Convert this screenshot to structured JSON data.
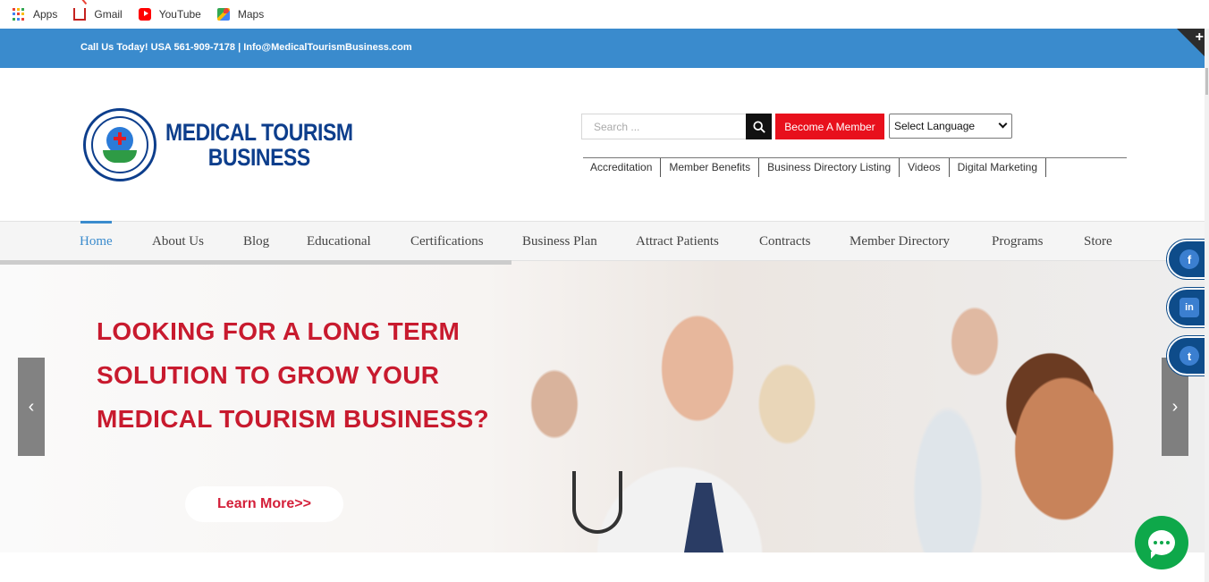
{
  "bookmarks": [
    {
      "label": "Apps",
      "icon": "apps-grid-icon"
    },
    {
      "label": "Gmail",
      "icon": "gmail-icon"
    },
    {
      "label": "YouTube",
      "icon": "youtube-icon"
    },
    {
      "label": "Maps",
      "icon": "maps-icon"
    }
  ],
  "topbar": {
    "contact": "Call Us Today! USA 561-909-7178  |  Info@MedicalTourismBusiness.com",
    "corner_symbol": "+",
    "color": "#3a8bcd"
  },
  "logo": {
    "line1": "MEDICAL TOURISM",
    "line2": "BUSINESS",
    "color": "#0d3e8c"
  },
  "search": {
    "placeholder": "Search ..."
  },
  "member_button": {
    "label": "Become A Member",
    "color": "#e8101c"
  },
  "language": {
    "selected": "Select Language"
  },
  "secondary_nav": [
    "Accreditation",
    "Member Benefits",
    "Business Directory Listing",
    "Videos",
    "Digital Marketing"
  ],
  "main_nav": [
    "Home",
    "About Us",
    "Blog",
    "Educational",
    "Certifications",
    "Business Plan",
    "Attract Patients",
    "Contracts",
    "Member Directory",
    "Programs",
    "Store"
  ],
  "hero": {
    "title_lines": [
      "LOOKING FOR A LONG TERM",
      "SOLUTION TO GROW YOUR",
      "MEDICAL TOURISM BUSINESS?"
    ],
    "cta": "Learn More>>",
    "title_color": "#c81a2e"
  },
  "slider": {
    "prev": "‹",
    "next": "›"
  },
  "social": [
    {
      "name": "facebook",
      "glyph": "f"
    },
    {
      "name": "linkedin",
      "glyph": "in"
    },
    {
      "name": "twitter",
      "glyph": "t"
    }
  ]
}
